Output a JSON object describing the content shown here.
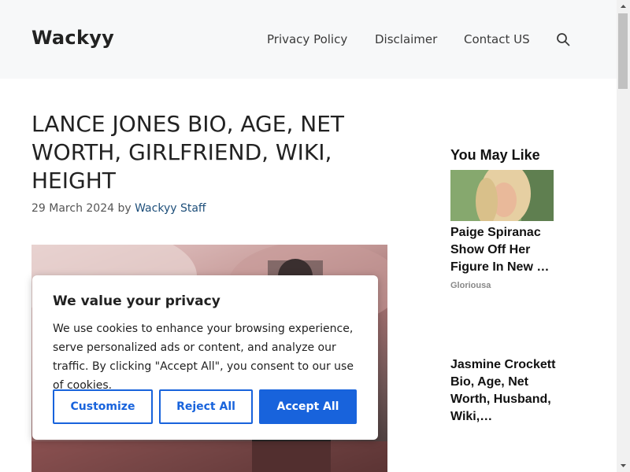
{
  "site": {
    "logo": "Wackyy"
  },
  "nav": {
    "items": [
      "Privacy Policy",
      "Disclaimer",
      "Contact US"
    ]
  },
  "article": {
    "title": "LANCE JONES BIO, AGE, NET WORTH, GIRLFRIEND, WIKI, HEIGHT",
    "date": "29 March 2024",
    "by": "by",
    "author": "Wackyy Staff"
  },
  "sidebar": {
    "heading": "You May Like",
    "ads": [
      {
        "title": "Paige Spiranac Show Off Her Figure In New …",
        "source": "Gloriousa"
      },
      {
        "title": "Jasmine Crockett Bio, Age, Net Worth, Husband, Wiki,…"
      }
    ]
  },
  "cookie": {
    "title": "We value your privacy",
    "text": "We use cookies to enhance your browsing experience, serve personalized ads or content, and analyze our traffic. By clicking \"Accept All\", you consent to our use of cookies.",
    "customize": "Customize",
    "reject": "Reject All",
    "accept": "Accept All"
  },
  "colors": {
    "accent": "#1863dc",
    "header_bg": "#f7f8f9",
    "link": "#1e4f7a"
  }
}
